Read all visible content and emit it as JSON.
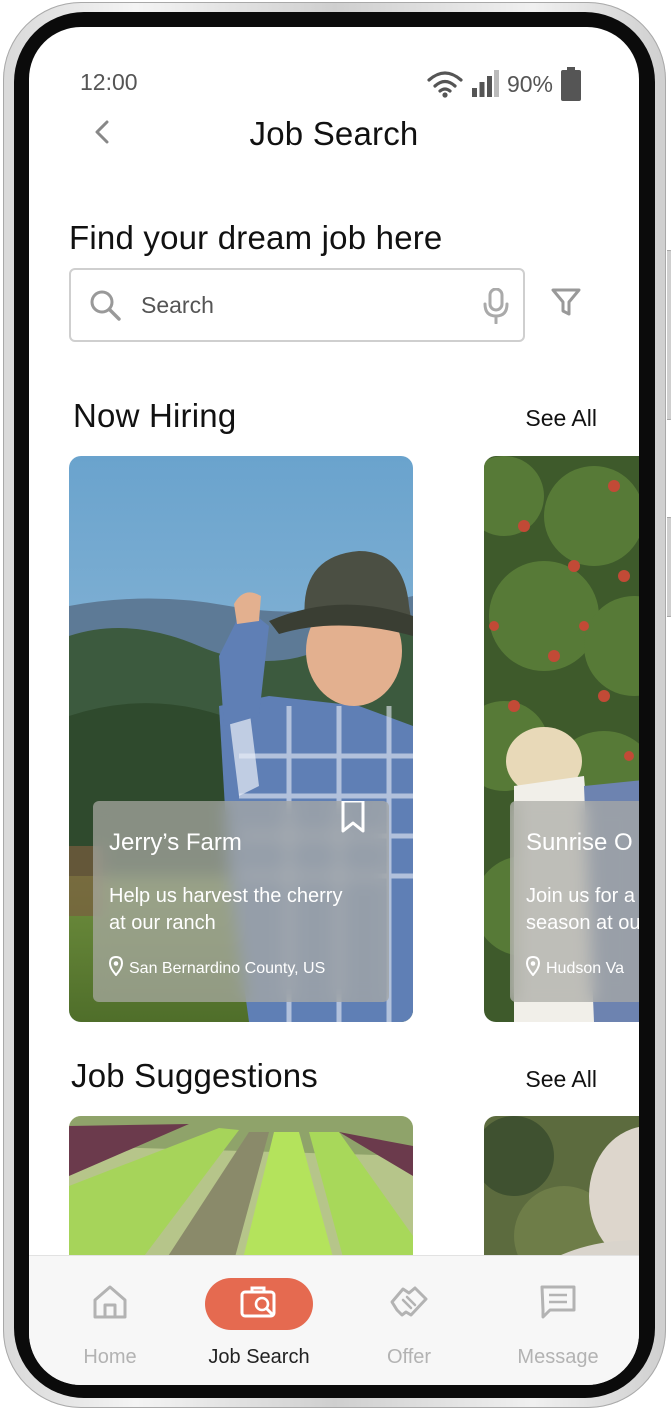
{
  "status_bar": {
    "time": "12:00",
    "battery": "90%"
  },
  "header": {
    "title": "Job Search"
  },
  "headline": "Find your dream job here",
  "search": {
    "placeholder": "Search"
  },
  "sections": {
    "now_hiring": {
      "title": "Now Hiring",
      "see_all": "See All"
    },
    "job_suggestions": {
      "title": "Job Suggestions",
      "see_all": "See All"
    }
  },
  "hiring_cards": [
    {
      "name": "Jerry’s Farm",
      "description": "Help us harvest the cherry\nat our ranch",
      "location": "San Bernardino County, US"
    },
    {
      "name": "Sunrise O",
      "description": "Join us for a\nseason at ou",
      "location": "Hudson Va"
    }
  ],
  "bottom_nav": [
    {
      "label": "Home",
      "icon": "home-icon",
      "active": false
    },
    {
      "label": "Job Search",
      "icon": "job-search-icon",
      "active": true
    },
    {
      "label": "Offer",
      "icon": "handshake-icon",
      "active": false
    },
    {
      "label": "Message",
      "icon": "message-icon",
      "active": false
    }
  ],
  "colors": {
    "accent": "#e56a50",
    "inactive": "#b3b3b3"
  }
}
